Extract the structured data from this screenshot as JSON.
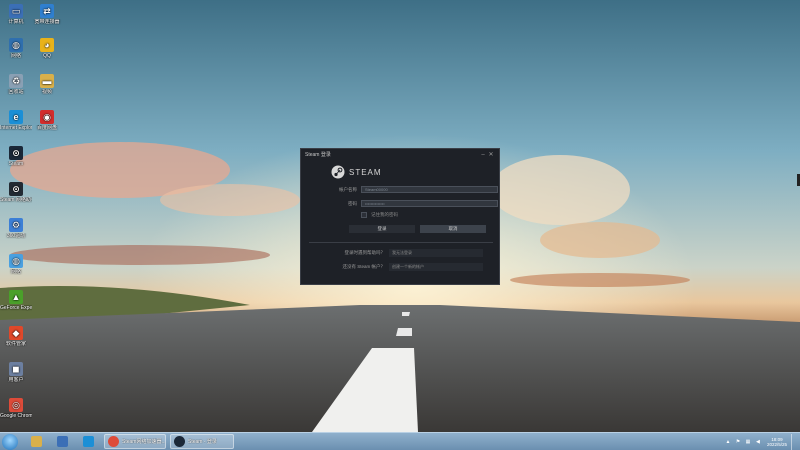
{
  "desktop": {
    "icons": [
      {
        "label": "计算机",
        "icon": "computer-icon",
        "color": "#3b6fb6",
        "glyph": "▭"
      },
      {
        "label": "宽带连接器",
        "icon": "network-icon",
        "color": "#2f7fcf",
        "glyph": "⇄"
      },
      {
        "label": "网络",
        "icon": "network-globe-icon",
        "color": "#2f6fae",
        "glyph": "◍"
      },
      {
        "label": "QQ",
        "icon": "qq-icon",
        "color": "#e8b21a",
        "glyph": "◕"
      },
      {
        "label": "回收站",
        "icon": "recycle-bin-icon",
        "color": "#8aa0b4",
        "glyph": "♻"
      },
      {
        "label": "视频",
        "icon": "folder-icon",
        "color": "#d9b04a",
        "glyph": "▬"
      },
      {
        "label": "Internet Explorer",
        "icon": "internet-explorer-icon",
        "color": "#1b8fd6",
        "glyph": "e"
      },
      {
        "label": "百度网盘",
        "icon": "netdisk-icon",
        "color": "#d22d2d",
        "glyph": "◉"
      },
      {
        "label": "Steam",
        "icon": "steam-icon",
        "color": "#1b2838",
        "glyph": "⊙"
      },
      {
        "label": "Steam 网络助手",
        "icon": "steam-helper-icon",
        "color": "#222a33",
        "glyph": "⊙"
      },
      {
        "label": "360驱动",
        "icon": "driver-icon",
        "color": "#3c7fd6",
        "glyph": "⚙"
      },
      {
        "label": "网络",
        "icon": "globe-icon",
        "color": "#4aa0e0",
        "glyph": "◍"
      },
      {
        "label": "GeForce Experience",
        "icon": "geforce-icon",
        "color": "#4aa02a",
        "glyph": "▲"
      },
      {
        "label": "软件管家",
        "icon": "software-manager-icon",
        "color": "#e0482a",
        "glyph": "◆"
      },
      {
        "label": "用客户",
        "icon": "app-icon",
        "color": "#6c7fa0",
        "glyph": "◼"
      },
      {
        "label": "Google Chrome",
        "icon": "chrome-icon",
        "color": "#dd4b39",
        "glyph": "◎"
      }
    ]
  },
  "steam_dialog": {
    "title": "Steam 登录",
    "logo_text": "STEAM",
    "account_label": "帐户名称",
    "account_value": "Steam00000",
    "password_label": "密码",
    "password_value": "••••••••••••••",
    "remember_label": "记住我的密码",
    "login_label": "登录",
    "cancel_label": "取消",
    "help_q1": "登录时遇到帮助吗？",
    "help_a1": "我无法登录",
    "help_q2": "还没有 Steam 帐户？",
    "help_a2": "创建一个新的帐户"
  },
  "taskbar": {
    "tasks": [
      {
        "label": "Steam网络加速器...",
        "icon": "chrome-taskbar-icon",
        "color": "#dd4b39"
      },
      {
        "label": "Steam - 登录",
        "icon": "steam-taskbar-icon",
        "color": "#1b2838"
      }
    ],
    "clock_time": "18:09",
    "clock_date": "2022/5/25"
  }
}
